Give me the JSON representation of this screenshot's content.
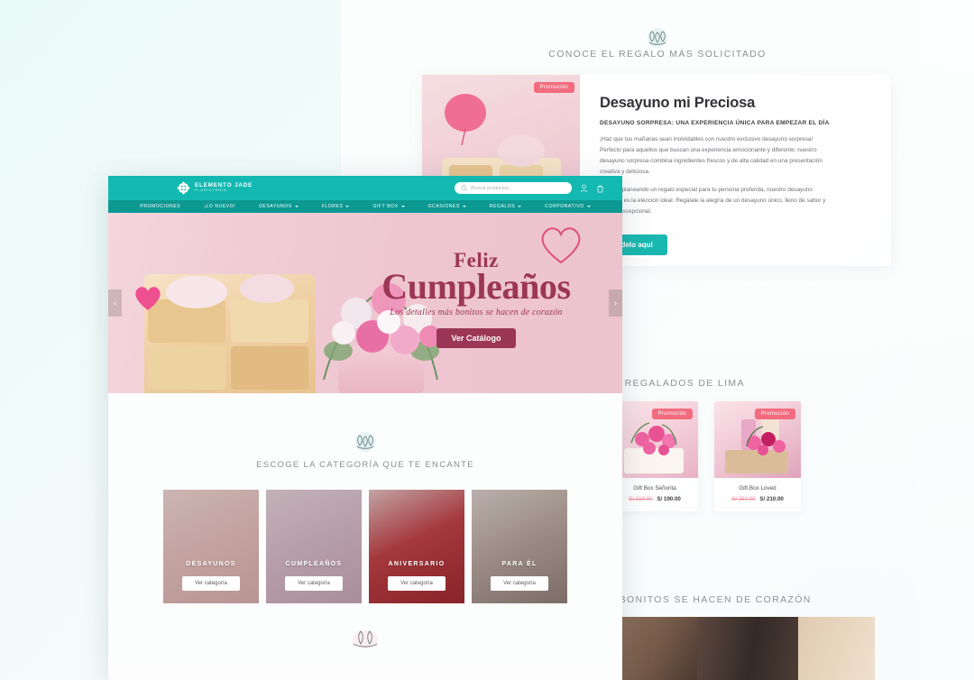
{
  "colors": {
    "teal_header": "#13b9b1",
    "teal_nav": "#0c9992",
    "maroon": "#9c3656",
    "promo_red": "#f2687a",
    "page_bg": "#eafaf8"
  },
  "background_page": {
    "section_1": {
      "ornament": "floral-ornament-icon",
      "heading": "CONOCE EL REGALO MÁS SOLICITADO",
      "card": {
        "badge": "Promoción",
        "title": "Desayuno mi Preciosa",
        "subtitle": "DESAYUNO SORPRESA: UNA EXPERIENCIA ÚNICA PARA EMPEZAR EL DÍA",
        "paragraph_1": "¡Haz que tus mañanas sean inolvidables con nuestro exclusivo desayuno sorpresa! Perfecto para aquellos que buscan una experiencia emocionante y diferente; nuestro desayuno sorpresa combina ingredientes frescos y de alta calidad en una presentación creativa y deliciosa.",
        "paragraph_2": "Si estás planeando un regalo especial para tu persona preferida, nuestro desayuno sorpresa es la elección ideal. Regálale la alegría de un desayuno único, lleno de sabor y calidad excepcional.",
        "button": "Pídelo aquí"
      }
    },
    "section_2": {
      "heading": "LOS MÁS REGALADOS DE LIMA",
      "products": [
        {
          "badge": "Promoción",
          "name": "Gift Box Señorita",
          "old_price": "S/ 210.00",
          "price": "S/ 190.00"
        },
        {
          "badge": "Promoción",
          "name": "Gift Box Loved",
          "old_price": "S/ 250.00",
          "price": "S/ 210.00"
        }
      ]
    },
    "section_3": {
      "heading": "LOS DETALLES MÁS BONITOS SE HACEN DE CORAZÓN"
    }
  },
  "front_window": {
    "header": {
      "brand_name": "ELEMENTO JADE",
      "brand_tagline": "FLORISTERIA",
      "logo_icon": "flower-logo-icon",
      "search_placeholder": "Buscar productos...",
      "search_icon": "search-icon",
      "account_icon": "user-icon",
      "cart_icon": "shopping-bag-icon"
    },
    "nav": [
      {
        "label": "PROMOCIONES",
        "has_caret": false
      },
      {
        "label": "¡LO NUEVO!",
        "has_caret": false
      },
      {
        "label": "DESAYUNOS",
        "has_caret": true
      },
      {
        "label": "FLORES",
        "has_caret": true
      },
      {
        "label": "GIFT BOX",
        "has_caret": true
      },
      {
        "label": "OCASIONES",
        "has_caret": true
      },
      {
        "label": "REGALOS",
        "has_caret": true
      },
      {
        "label": "CORPORATIVO",
        "has_caret": true
      }
    ],
    "hero": {
      "prev_icon": "chevron-left-icon",
      "next_icon": "chevron-right-icon",
      "line_1": "Feliz",
      "line_2": "Cumpleaños",
      "tagline": "Los detalles más bonitos se hacen de corazón",
      "cta": "Ver Catálogo"
    },
    "categories_section": {
      "ornament": "floral-ornament-icon",
      "heading": "ESCOGE LA CATEGORÍA QUE TE ENCANTE",
      "bottom_ornament": "floral-ornament-icon",
      "cards": [
        {
          "label": "DESAYUNOS",
          "button": "Ver categoría"
        },
        {
          "label": "CUMPLEAÑOS",
          "button": "Ver categoría"
        },
        {
          "label": "ANIVERSARIO",
          "button": "Ver categoría"
        },
        {
          "label": "PARA ÉL",
          "button": "Ver categoría"
        }
      ]
    }
  }
}
